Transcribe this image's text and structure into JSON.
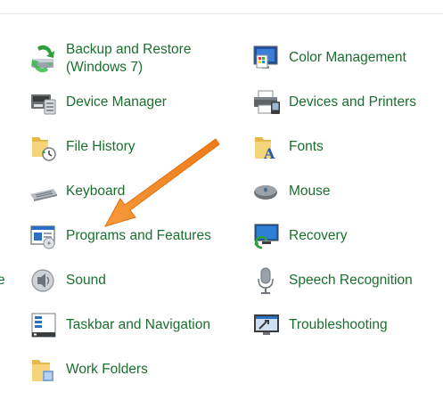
{
  "items_left": [
    {
      "label": "Backup and Restore (Windows 7)",
      "icon": "backup-restore-icon"
    },
    {
      "label": "Device Manager",
      "icon": "device-manager-icon"
    },
    {
      "label": "File History",
      "icon": "file-history-icon"
    },
    {
      "label": "Keyboard",
      "icon": "keyboard-icon"
    },
    {
      "label": "Programs and Features",
      "icon": "programs-features-icon"
    },
    {
      "label": "Sound",
      "icon": "speaker-icon"
    },
    {
      "label": "Taskbar and Navigation",
      "icon": "taskbar-icon"
    },
    {
      "label": "Work Folders",
      "icon": "work-folders-icon"
    }
  ],
  "items_right": [
    {
      "label": "Color Management",
      "icon": "color-management-icon"
    },
    {
      "label": "Devices and Printers",
      "icon": "printer-icon"
    },
    {
      "label": "Fonts",
      "icon": "fonts-folder-icon"
    },
    {
      "label": "Mouse",
      "icon": "mouse-icon"
    },
    {
      "label": "Recovery",
      "icon": "recovery-icon"
    },
    {
      "label": "Speech Recognition",
      "icon": "microphone-icon"
    },
    {
      "label": "Troubleshooting",
      "icon": "troubleshooting-icon"
    }
  ],
  "cut_off_text": "e",
  "colors": {
    "link_green": "#1a6e2e",
    "arrow_orange": "#f07c1b",
    "background": "#ffffff"
  }
}
